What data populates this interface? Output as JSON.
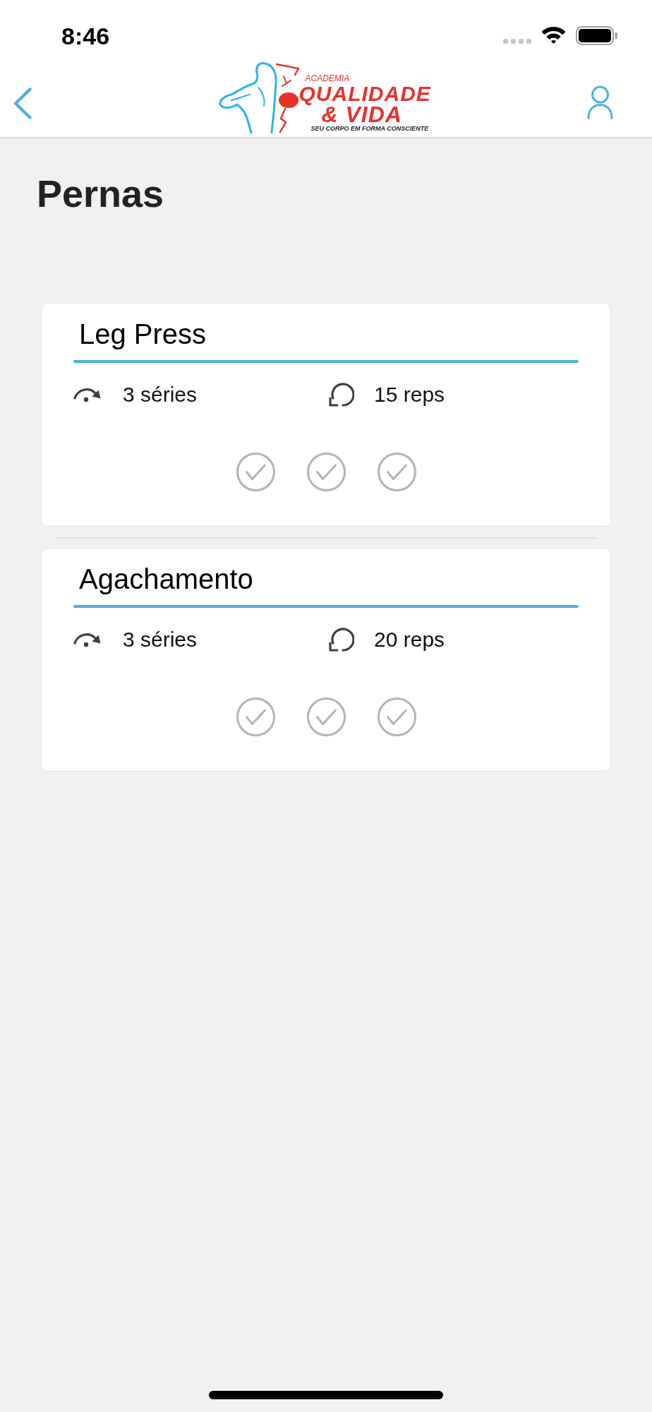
{
  "status_bar": {
    "time": "8:46"
  },
  "header": {
    "logo": {
      "overline": "ACADEMIA",
      "title": "QUALIDADE",
      "subtitle": "& VIDA",
      "tagline": "SEU CORPO EM FORMA CONSCIENTE"
    }
  },
  "page_title": "Pernas",
  "exercises": [
    {
      "name": "Leg Press",
      "series": "3 séries",
      "reps": "15 reps",
      "sets": [
        {
          "checked": false
        },
        {
          "checked": false
        },
        {
          "checked": false
        }
      ]
    },
    {
      "name": "Agachamento",
      "series": "3 séries",
      "reps": "20 reps",
      "sets": [
        {
          "checked": false
        },
        {
          "checked": false
        },
        {
          "checked": false
        }
      ]
    }
  ]
}
